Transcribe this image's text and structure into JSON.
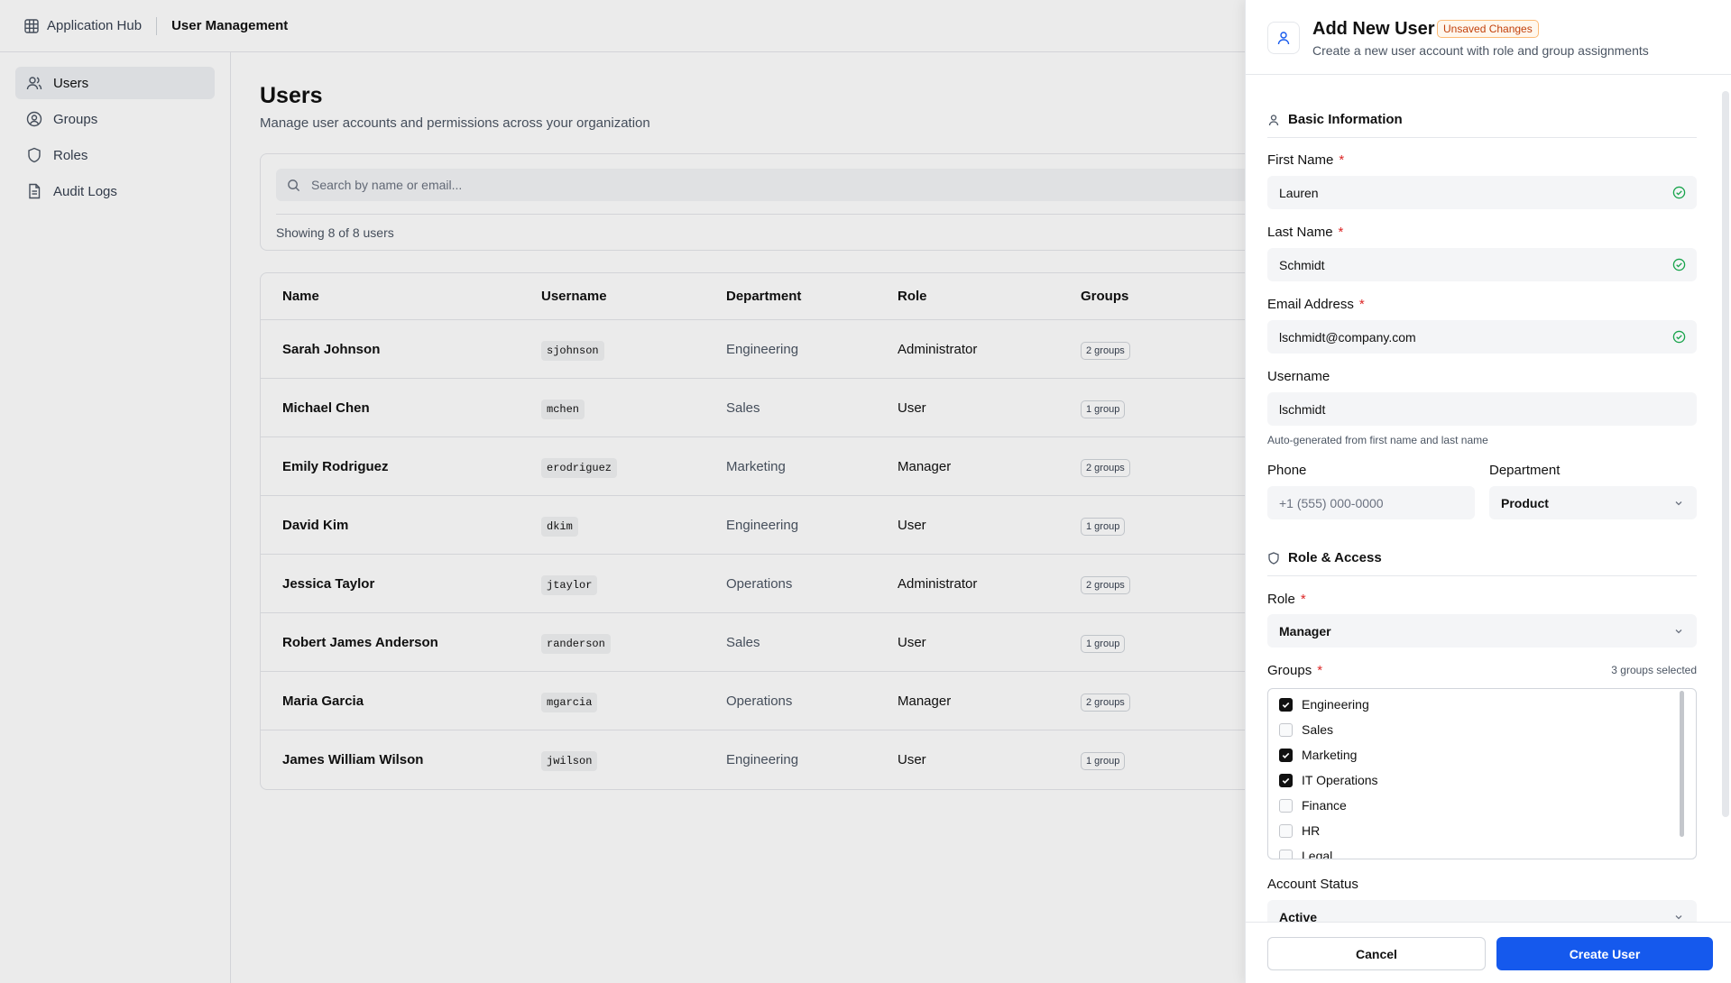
{
  "topbar": {
    "app_name": "Application Hub",
    "section": "User Management"
  },
  "sidebar": {
    "items": [
      {
        "label": "Users",
        "icon": "users-icon",
        "active": true
      },
      {
        "label": "Groups",
        "icon": "groups-icon",
        "active": false
      },
      {
        "label": "Roles",
        "icon": "shield-icon",
        "active": false
      },
      {
        "label": "Audit Logs",
        "icon": "document-icon",
        "active": false
      }
    ]
  },
  "main": {
    "title": "Users",
    "subtitle": "Manage user accounts and permissions across your organization",
    "search_placeholder": "Search by name or email...",
    "showing": "Showing 8 of 8 users",
    "columns": [
      "Name",
      "Username",
      "Department",
      "Role",
      "Groups"
    ],
    "rows": [
      {
        "name": "Sarah Johnson",
        "username": "sjohnson",
        "department": "Engineering",
        "role": "Administrator",
        "groups": "2 groups"
      },
      {
        "name": "Michael Chen",
        "username": "mchen",
        "department": "Sales",
        "role": "User",
        "groups": "1 group"
      },
      {
        "name": "Emily Rodriguez",
        "username": "erodriguez",
        "department": "Marketing",
        "role": "Manager",
        "groups": "2 groups"
      },
      {
        "name": "David Kim",
        "username": "dkim",
        "department": "Engineering",
        "role": "User",
        "groups": "1 group"
      },
      {
        "name": "Jessica Taylor",
        "username": "jtaylor",
        "department": "Operations",
        "role": "Administrator",
        "groups": "2 groups"
      },
      {
        "name": "Robert James Anderson",
        "username": "randerson",
        "department": "Sales",
        "role": "User",
        "groups": "1 group"
      },
      {
        "name": "Maria Garcia",
        "username": "mgarcia",
        "department": "Operations",
        "role": "Manager",
        "groups": "2 groups"
      },
      {
        "name": "James William Wilson",
        "username": "jwilson",
        "department": "Engineering",
        "role": "User",
        "groups": "1 group"
      }
    ]
  },
  "panel": {
    "title": "Add New User",
    "badge": "Unsaved Changes",
    "subtitle": "Create a new user account with role and group assignments",
    "basic_title": "Basic Information",
    "first_name_label": "First Name",
    "first_name_value": "Lauren",
    "last_name_label": "Last Name",
    "last_name_value": "Schmidt",
    "email_label": "Email Address",
    "email_value": "lschmidt@company.com",
    "username_label": "Username",
    "username_value": "lschmidt",
    "username_hint": "Auto-generated from first name and last name",
    "phone_label": "Phone",
    "phone_placeholder": "+1 (555) 000-0000",
    "department_label": "Department",
    "department_value": "Product",
    "role_section_title": "Role & Access",
    "role_label": "Role",
    "role_value": "Manager",
    "groups_label": "Groups",
    "groups_count": "3 groups selected",
    "groups": [
      {
        "label": "Engineering",
        "checked": true
      },
      {
        "label": "Sales",
        "checked": false
      },
      {
        "label": "Marketing",
        "checked": true
      },
      {
        "label": "IT Operations",
        "checked": true
      },
      {
        "label": "Finance",
        "checked": false
      },
      {
        "label": "HR",
        "checked": false
      },
      {
        "label": "Legal",
        "checked": false
      }
    ],
    "status_label": "Account Status",
    "status_value": "Active",
    "cancel_label": "Cancel",
    "create_label": "Create User",
    "required_mark": "*"
  },
  "colors": {
    "primary": "#1559ed",
    "required": "#dc2626",
    "success": "#16a34a",
    "badge_text": "#c2410c"
  }
}
